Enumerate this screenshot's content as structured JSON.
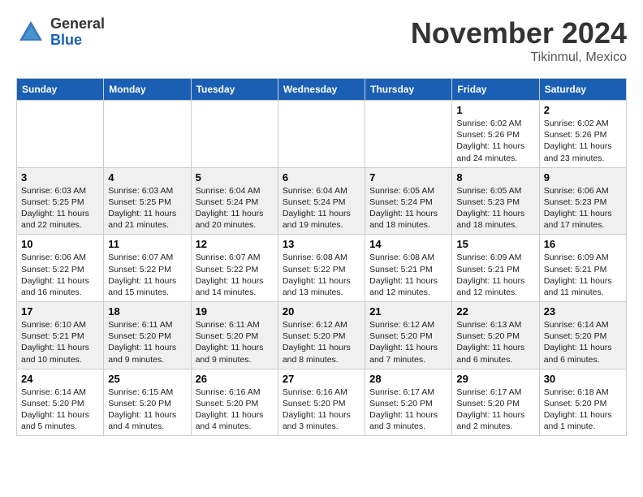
{
  "header": {
    "logo_general": "General",
    "logo_blue": "Blue",
    "title": "November 2024",
    "subtitle": "Tikinmul, Mexico"
  },
  "weekdays": [
    "Sunday",
    "Monday",
    "Tuesday",
    "Wednesday",
    "Thursday",
    "Friday",
    "Saturday"
  ],
  "weeks": [
    [
      {
        "day": "",
        "info": ""
      },
      {
        "day": "",
        "info": ""
      },
      {
        "day": "",
        "info": ""
      },
      {
        "day": "",
        "info": ""
      },
      {
        "day": "",
        "info": ""
      },
      {
        "day": "1",
        "info": "Sunrise: 6:02 AM\nSunset: 5:26 PM\nDaylight: 11 hours and 24 minutes."
      },
      {
        "day": "2",
        "info": "Sunrise: 6:02 AM\nSunset: 5:26 PM\nDaylight: 11 hours and 23 minutes."
      }
    ],
    [
      {
        "day": "3",
        "info": "Sunrise: 6:03 AM\nSunset: 5:25 PM\nDaylight: 11 hours and 22 minutes."
      },
      {
        "day": "4",
        "info": "Sunrise: 6:03 AM\nSunset: 5:25 PM\nDaylight: 11 hours and 21 minutes."
      },
      {
        "day": "5",
        "info": "Sunrise: 6:04 AM\nSunset: 5:24 PM\nDaylight: 11 hours and 20 minutes."
      },
      {
        "day": "6",
        "info": "Sunrise: 6:04 AM\nSunset: 5:24 PM\nDaylight: 11 hours and 19 minutes."
      },
      {
        "day": "7",
        "info": "Sunrise: 6:05 AM\nSunset: 5:24 PM\nDaylight: 11 hours and 18 minutes."
      },
      {
        "day": "8",
        "info": "Sunrise: 6:05 AM\nSunset: 5:23 PM\nDaylight: 11 hours and 18 minutes."
      },
      {
        "day": "9",
        "info": "Sunrise: 6:06 AM\nSunset: 5:23 PM\nDaylight: 11 hours and 17 minutes."
      }
    ],
    [
      {
        "day": "10",
        "info": "Sunrise: 6:06 AM\nSunset: 5:22 PM\nDaylight: 11 hours and 16 minutes."
      },
      {
        "day": "11",
        "info": "Sunrise: 6:07 AM\nSunset: 5:22 PM\nDaylight: 11 hours and 15 minutes."
      },
      {
        "day": "12",
        "info": "Sunrise: 6:07 AM\nSunset: 5:22 PM\nDaylight: 11 hours and 14 minutes."
      },
      {
        "day": "13",
        "info": "Sunrise: 6:08 AM\nSunset: 5:22 PM\nDaylight: 11 hours and 13 minutes."
      },
      {
        "day": "14",
        "info": "Sunrise: 6:08 AM\nSunset: 5:21 PM\nDaylight: 11 hours and 12 minutes."
      },
      {
        "day": "15",
        "info": "Sunrise: 6:09 AM\nSunset: 5:21 PM\nDaylight: 11 hours and 12 minutes."
      },
      {
        "day": "16",
        "info": "Sunrise: 6:09 AM\nSunset: 5:21 PM\nDaylight: 11 hours and 11 minutes."
      }
    ],
    [
      {
        "day": "17",
        "info": "Sunrise: 6:10 AM\nSunset: 5:21 PM\nDaylight: 11 hours and 10 minutes."
      },
      {
        "day": "18",
        "info": "Sunrise: 6:11 AM\nSunset: 5:20 PM\nDaylight: 11 hours and 9 minutes."
      },
      {
        "day": "19",
        "info": "Sunrise: 6:11 AM\nSunset: 5:20 PM\nDaylight: 11 hours and 9 minutes."
      },
      {
        "day": "20",
        "info": "Sunrise: 6:12 AM\nSunset: 5:20 PM\nDaylight: 11 hours and 8 minutes."
      },
      {
        "day": "21",
        "info": "Sunrise: 6:12 AM\nSunset: 5:20 PM\nDaylight: 11 hours and 7 minutes."
      },
      {
        "day": "22",
        "info": "Sunrise: 6:13 AM\nSunset: 5:20 PM\nDaylight: 11 hours and 6 minutes."
      },
      {
        "day": "23",
        "info": "Sunrise: 6:14 AM\nSunset: 5:20 PM\nDaylight: 11 hours and 6 minutes."
      }
    ],
    [
      {
        "day": "24",
        "info": "Sunrise: 6:14 AM\nSunset: 5:20 PM\nDaylight: 11 hours and 5 minutes."
      },
      {
        "day": "25",
        "info": "Sunrise: 6:15 AM\nSunset: 5:20 PM\nDaylight: 11 hours and 4 minutes."
      },
      {
        "day": "26",
        "info": "Sunrise: 6:16 AM\nSunset: 5:20 PM\nDaylight: 11 hours and 4 minutes."
      },
      {
        "day": "27",
        "info": "Sunrise: 6:16 AM\nSunset: 5:20 PM\nDaylight: 11 hours and 3 minutes."
      },
      {
        "day": "28",
        "info": "Sunrise: 6:17 AM\nSunset: 5:20 PM\nDaylight: 11 hours and 3 minutes."
      },
      {
        "day": "29",
        "info": "Sunrise: 6:17 AM\nSunset: 5:20 PM\nDaylight: 11 hours and 2 minutes."
      },
      {
        "day": "30",
        "info": "Sunrise: 6:18 AM\nSunset: 5:20 PM\nDaylight: 11 hours and 1 minute."
      }
    ]
  ]
}
